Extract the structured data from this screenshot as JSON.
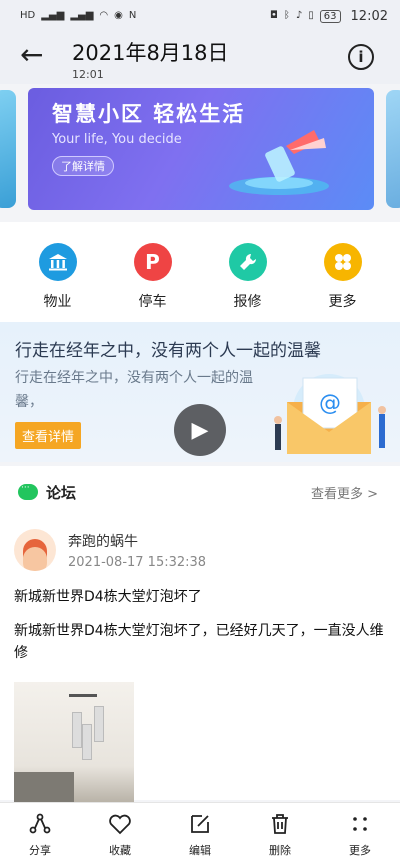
{
  "status_bar": {
    "left_icons": [
      "HD",
      "4G",
      "4G",
      "wifi-icon",
      "eye-icon",
      "nfc-icon"
    ],
    "right_icons": [
      "camera-icon",
      "bluetooth-icon",
      "mute-icon",
      "vibrate-icon"
    ],
    "battery": "63",
    "time": "12:02"
  },
  "header": {
    "title": "2021年8月18日",
    "subtitle": "12:01"
  },
  "banner": {
    "title": "智慧小区 轻松生活",
    "subtitle": "Your life, You decide",
    "button": "了解详情"
  },
  "services": [
    {
      "label": "物业",
      "icon": "building-icon",
      "color": "#1e9be0"
    },
    {
      "label": "停车",
      "icon": "parking-icon",
      "color": "#ef4444"
    },
    {
      "label": "报修",
      "icon": "wrench-icon",
      "color": "#1fc9a5"
    },
    {
      "label": "更多",
      "icon": "clover-icon",
      "color": "#f7b500"
    }
  ],
  "promo": {
    "title": "行走在经年之中，没有两个人一起的温馨",
    "text": "行走在经年之中，没有两个人一起的温馨，",
    "button": "查看详情",
    "accent": "#f5a623"
  },
  "forum": {
    "title": "论坛",
    "more": "查看更多 >",
    "post": {
      "user": "奔跑的蜗牛",
      "time": "2021-08-17 15:32:38",
      "title": "新城新世界D4栋大堂灯泡坏了",
      "body": "新城新世界D4栋大堂灯泡坏了，已经好几天了，一直没人维修"
    }
  },
  "bottom_bar": [
    {
      "label": "分享",
      "icon": "share-icon"
    },
    {
      "label": "收藏",
      "icon": "heart-icon"
    },
    {
      "label": "编辑",
      "icon": "edit-icon"
    },
    {
      "label": "删除",
      "icon": "trash-icon"
    },
    {
      "label": "更多",
      "icon": "more-icon"
    }
  ]
}
